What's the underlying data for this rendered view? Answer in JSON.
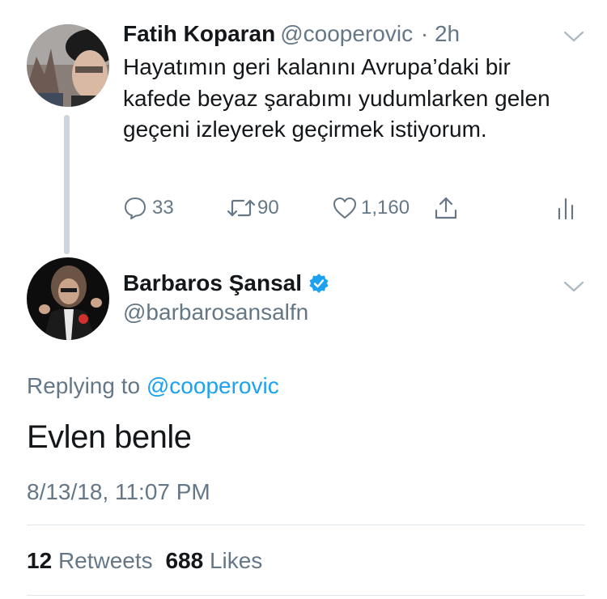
{
  "original_tweet": {
    "author_name": "Fatih Koparan",
    "handle": "@cooperovic",
    "separator": "·",
    "time_ago": "2h",
    "text": "Hayatımın geri kalanını Avrupa’daki bir kafede beyaz şarabımı yudumlarken gelen geçeni izleyerek geçirmek istiyorum.",
    "actions": {
      "reply_count": "33",
      "retweet_count": "90",
      "like_count": "1,160"
    }
  },
  "reply_tweet": {
    "author_name": "Barbaros Şansal",
    "handle": "@barbarosansalfn",
    "verified": true,
    "replying_prefix": "Replying to",
    "replying_to": "@cooperovic",
    "text": "Evlen benle",
    "timestamp": "8/13/18, 11:07 PM",
    "stats": {
      "retweets_count": "12",
      "retweets_label": "Retweets",
      "likes_count": "688",
      "likes_label": "Likes"
    }
  },
  "colors": {
    "text": "#14171a",
    "secondary": "#657786",
    "link": "#1da1f2",
    "verified": "#1da1f2",
    "divider": "#e1e8ed"
  },
  "icons": [
    "reply-icon",
    "retweet-icon",
    "like-icon",
    "share-icon",
    "analytics-icon",
    "chevron-down-icon",
    "verified-badge-icon"
  ]
}
